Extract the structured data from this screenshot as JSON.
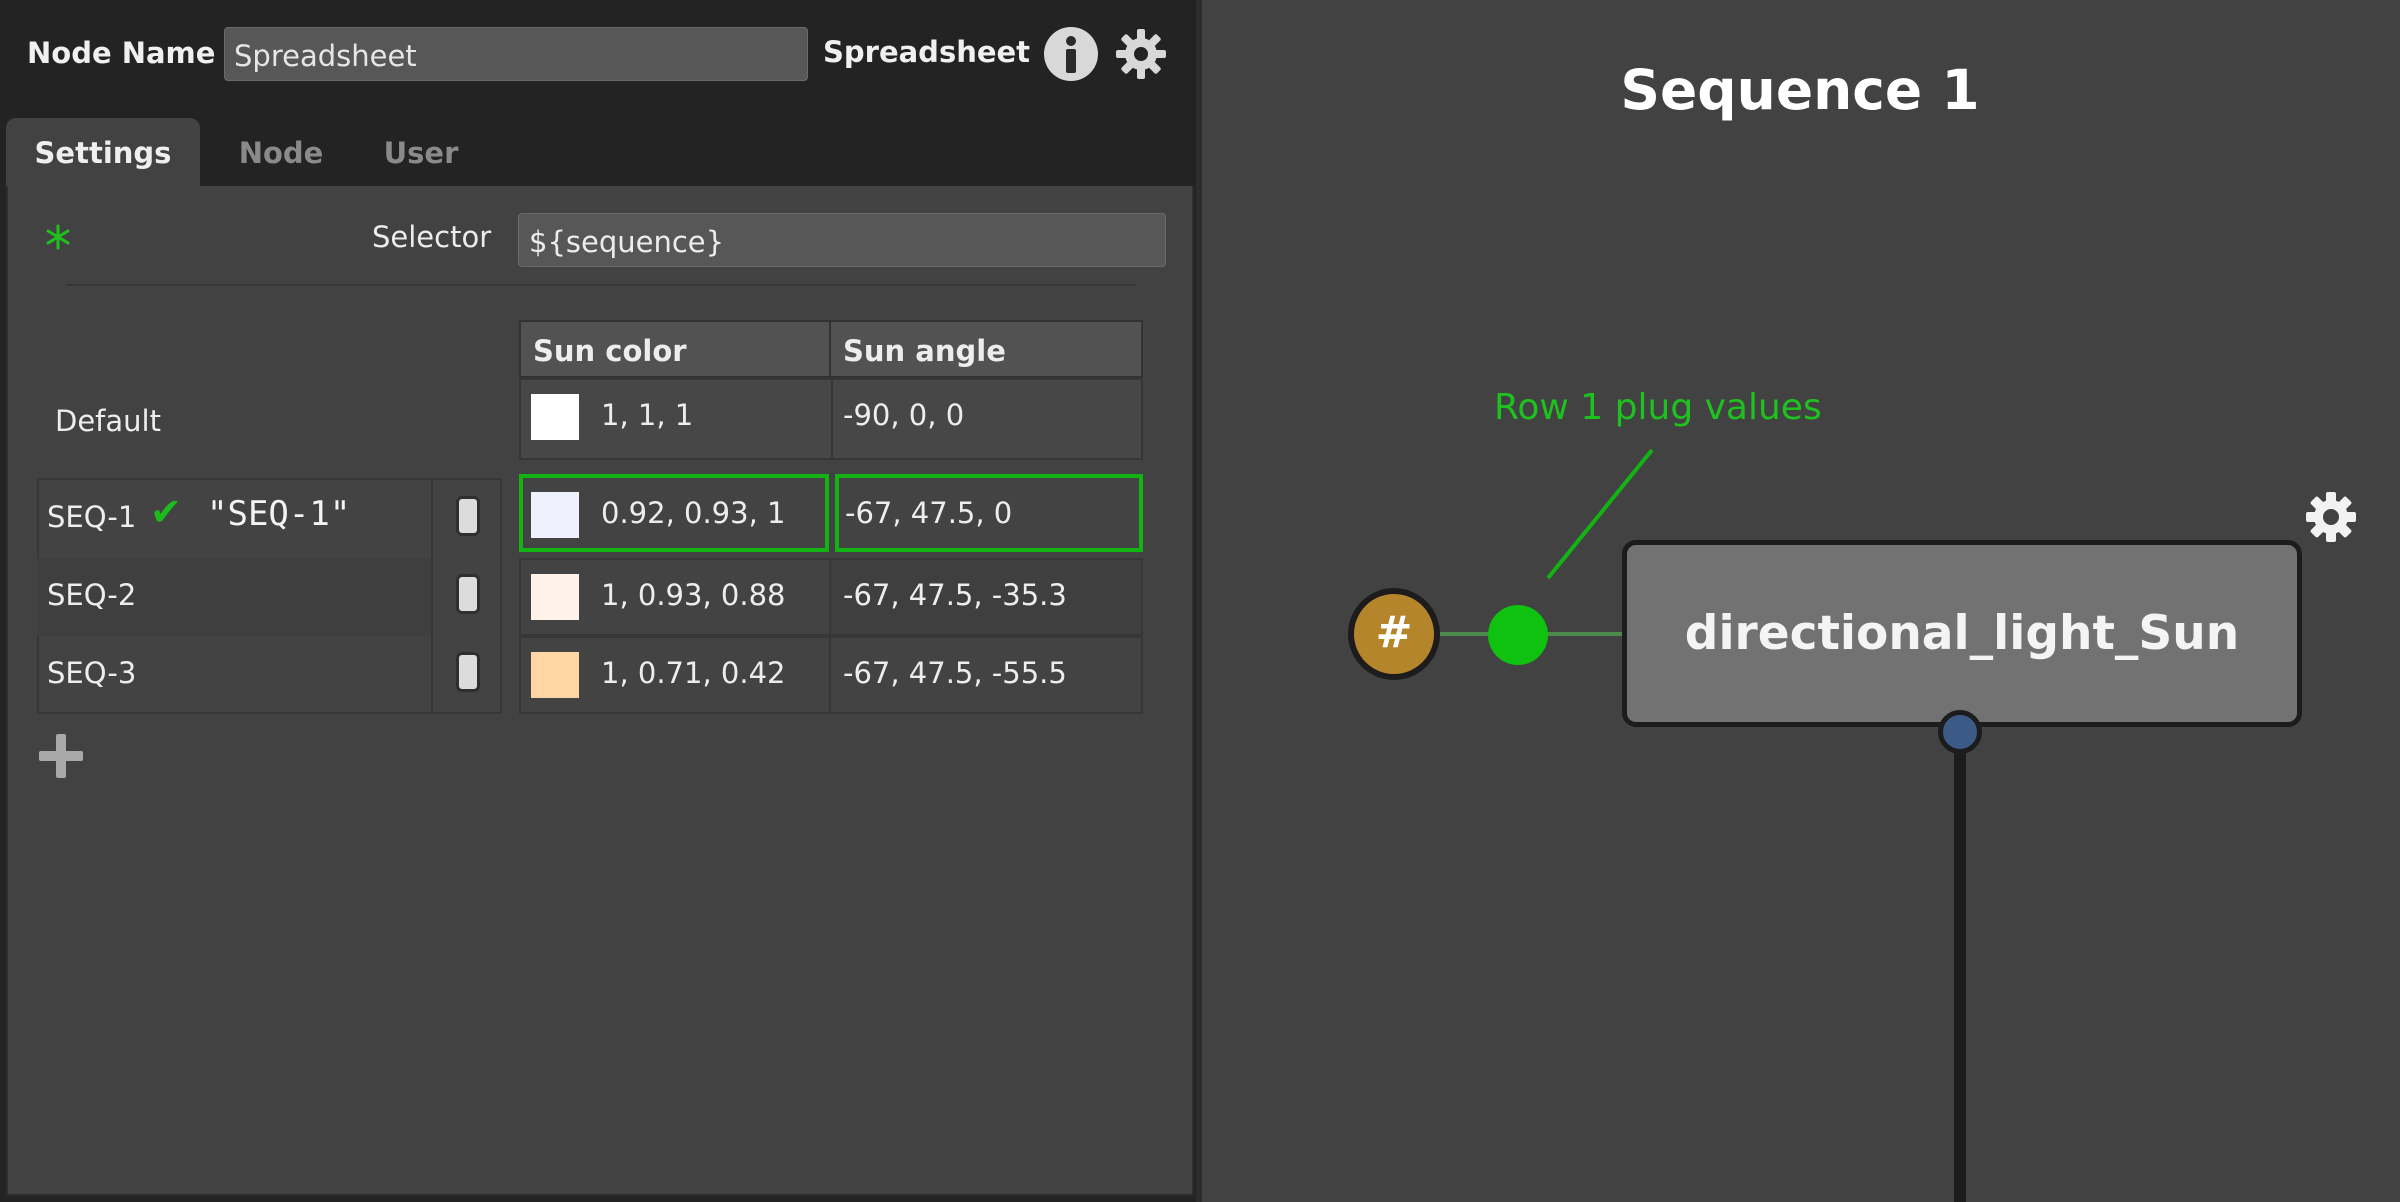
{
  "header": {
    "name_label": "Node Name",
    "name_value": "Spreadsheet",
    "node_type": "Spreadsheet",
    "info_icon": "info-icon",
    "settings_icon": "gear-icon"
  },
  "tabs": [
    {
      "label": "Settings",
      "active": true
    },
    {
      "label": "Node",
      "active": false
    },
    {
      "label": "User",
      "active": false
    }
  ],
  "settings": {
    "selector_label": "Selector",
    "selector_value": "${sequence}"
  },
  "table": {
    "columns": [
      "Sun color",
      "Sun angle"
    ],
    "default_row": {
      "label": "Default",
      "sun_color": "1, 1, 1",
      "sun_color_swatch": "#ffffff",
      "sun_angle": "-90, 0, 0"
    },
    "rows": [
      {
        "name": "SEQ-1",
        "active_marker": "✔",
        "quoted": "\"SEQ-1\"",
        "enabled": true,
        "sun_color": "0.92, 0.93, 1",
        "sun_color_swatch": "#eff2fd",
        "sun_angle": "-67, 47.5, 0",
        "highlighted": true
      },
      {
        "name": "SEQ-2",
        "enabled": true,
        "sun_color": "1, 0.93, 0.88",
        "sun_color_swatch": "#fff2e8",
        "sun_angle": "-67, 47.5, -35.3",
        "highlighted": false
      },
      {
        "name": "SEQ-3",
        "enabled": true,
        "sun_color": "1, 0.71, 0.42",
        "sun_color_swatch": "#ffd6a4",
        "sun_angle": "-67, 47.5, -55.5",
        "highlighted": false
      }
    ],
    "add_row_icon": "plus-icon"
  },
  "graph": {
    "title": "Sequence 1",
    "annotation": "Row 1 plug values",
    "node_name": "directional_light_Sun",
    "hash_plug_label": "#",
    "colors": {
      "highlight": "#12b312",
      "hash_plug": "#b5852b",
      "output_plug": "#3c5a86"
    }
  }
}
